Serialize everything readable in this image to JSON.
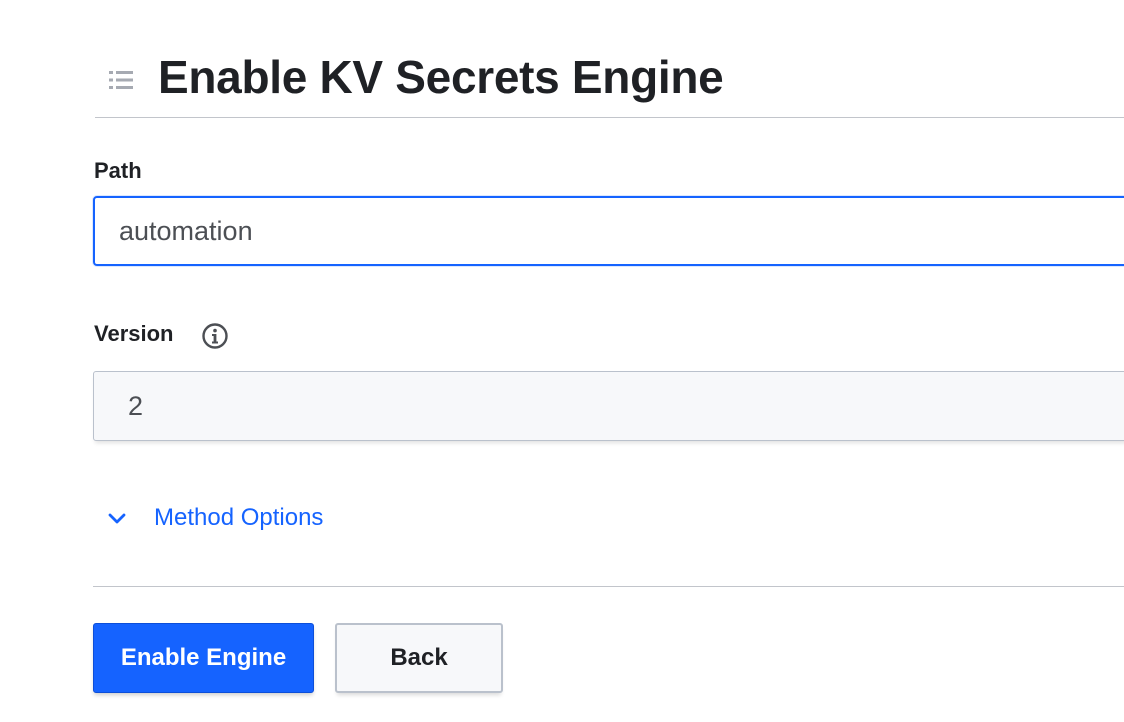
{
  "header": {
    "title": "Enable KV Secrets Engine",
    "icon": "list-icon"
  },
  "form": {
    "path": {
      "label": "Path",
      "value": "automation"
    },
    "version": {
      "label": "Version",
      "info_icon": "info-icon",
      "value": "2"
    },
    "method_options": {
      "label": "Method Options",
      "icon": "chevron-down-icon"
    }
  },
  "actions": {
    "enable_label": "Enable Engine",
    "back_label": "Back"
  },
  "colors": {
    "accent": "#1563ff",
    "text": "#1f2125",
    "muted_bg": "#f7f8fa",
    "border": "#bac1cc"
  }
}
